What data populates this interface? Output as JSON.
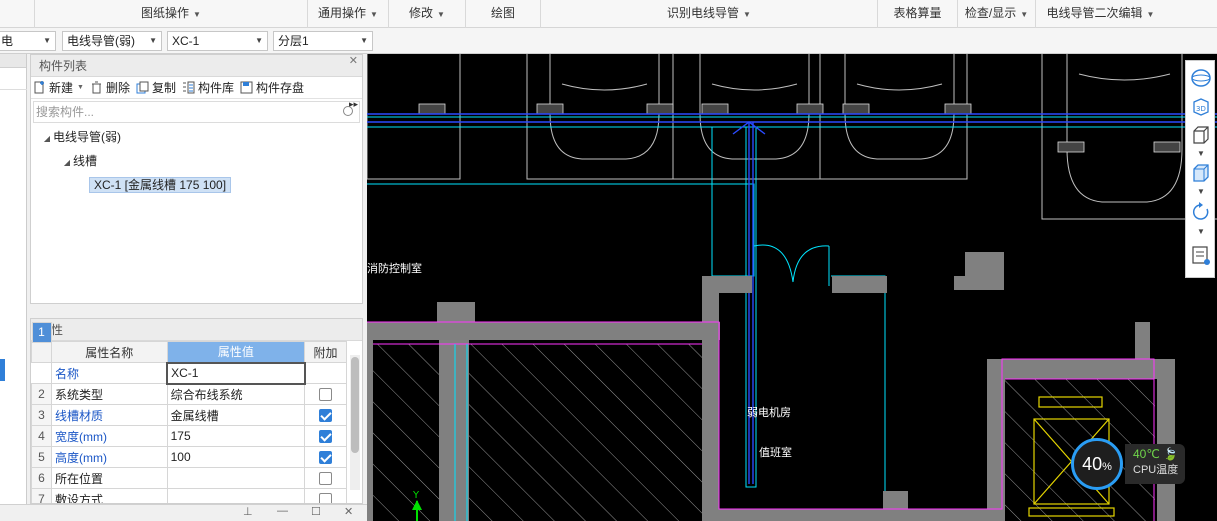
{
  "ribbon": {
    "groups": [
      {
        "label": "图纸操作",
        "caret": true
      },
      {
        "label": "通用操作",
        "caret": true
      },
      {
        "label": "修改",
        "caret": true
      },
      {
        "label": "绘图",
        "caret": false
      },
      {
        "label": "识别电线导管",
        "caret": true
      },
      {
        "label": "表格算量",
        "caret": false
      },
      {
        "label": "检查/显示",
        "caret": true
      },
      {
        "label": "电线导管二次编辑",
        "caret": true
      }
    ]
  },
  "selectors": {
    "discipline": "电",
    "type": "电线导管(弱)",
    "component": "XC-1",
    "layer": "分层1"
  },
  "component_list": {
    "title": "构件列表",
    "toolbar": {
      "new": "新建",
      "delete": "删除",
      "copy": "复制",
      "library": "构件库",
      "save": "构件存盘",
      "more": "▸▸"
    },
    "search_placeholder": "搜索构件...",
    "tree": {
      "root": "电线导管(弱)",
      "child": "线槽",
      "leaf": "XC-1 [金属线槽 175 100]"
    }
  },
  "properties": {
    "title": "属性",
    "headers": {
      "name": "属性名称",
      "value": "属性值",
      "extra": "附加"
    },
    "rows": [
      {
        "num": "1",
        "name": "名称",
        "value": "XC-1",
        "blue": true,
        "check": null
      },
      {
        "num": "2",
        "name": "系统类型",
        "value": "综合布线系统",
        "blue": false,
        "check": false
      },
      {
        "num": "3",
        "name": "线槽材质",
        "value": "金属线槽",
        "blue": true,
        "check": true
      },
      {
        "num": "4",
        "name": "宽度(mm)",
        "value": "175",
        "blue": true,
        "check": true
      },
      {
        "num": "5",
        "name": "高度(mm)",
        "value": "100",
        "blue": true,
        "check": true
      },
      {
        "num": "6",
        "name": "所在位置",
        "value": "",
        "blue": false,
        "check": false
      },
      {
        "num": "7",
        "name": "敷设方式",
        "value": "",
        "blue": false,
        "check": false
      }
    ]
  },
  "cad_labels": {
    "room1": "消防控制室",
    "room2": "弱电机房",
    "room3": "值班室",
    "axis_y": "Y"
  },
  "cpu_widget": {
    "percent": "40",
    "percent_unit": "%",
    "temp": "40℃",
    "label": "CPU温度"
  },
  "colors": {
    "accent": "#2f7fd8",
    "header_highlight": "#7fb2ea",
    "cad_wall": "#808080",
    "cad_line": "#00e5ff",
    "cad_magenta": "#ff33ff",
    "cad_blue": "#2a4bff"
  }
}
